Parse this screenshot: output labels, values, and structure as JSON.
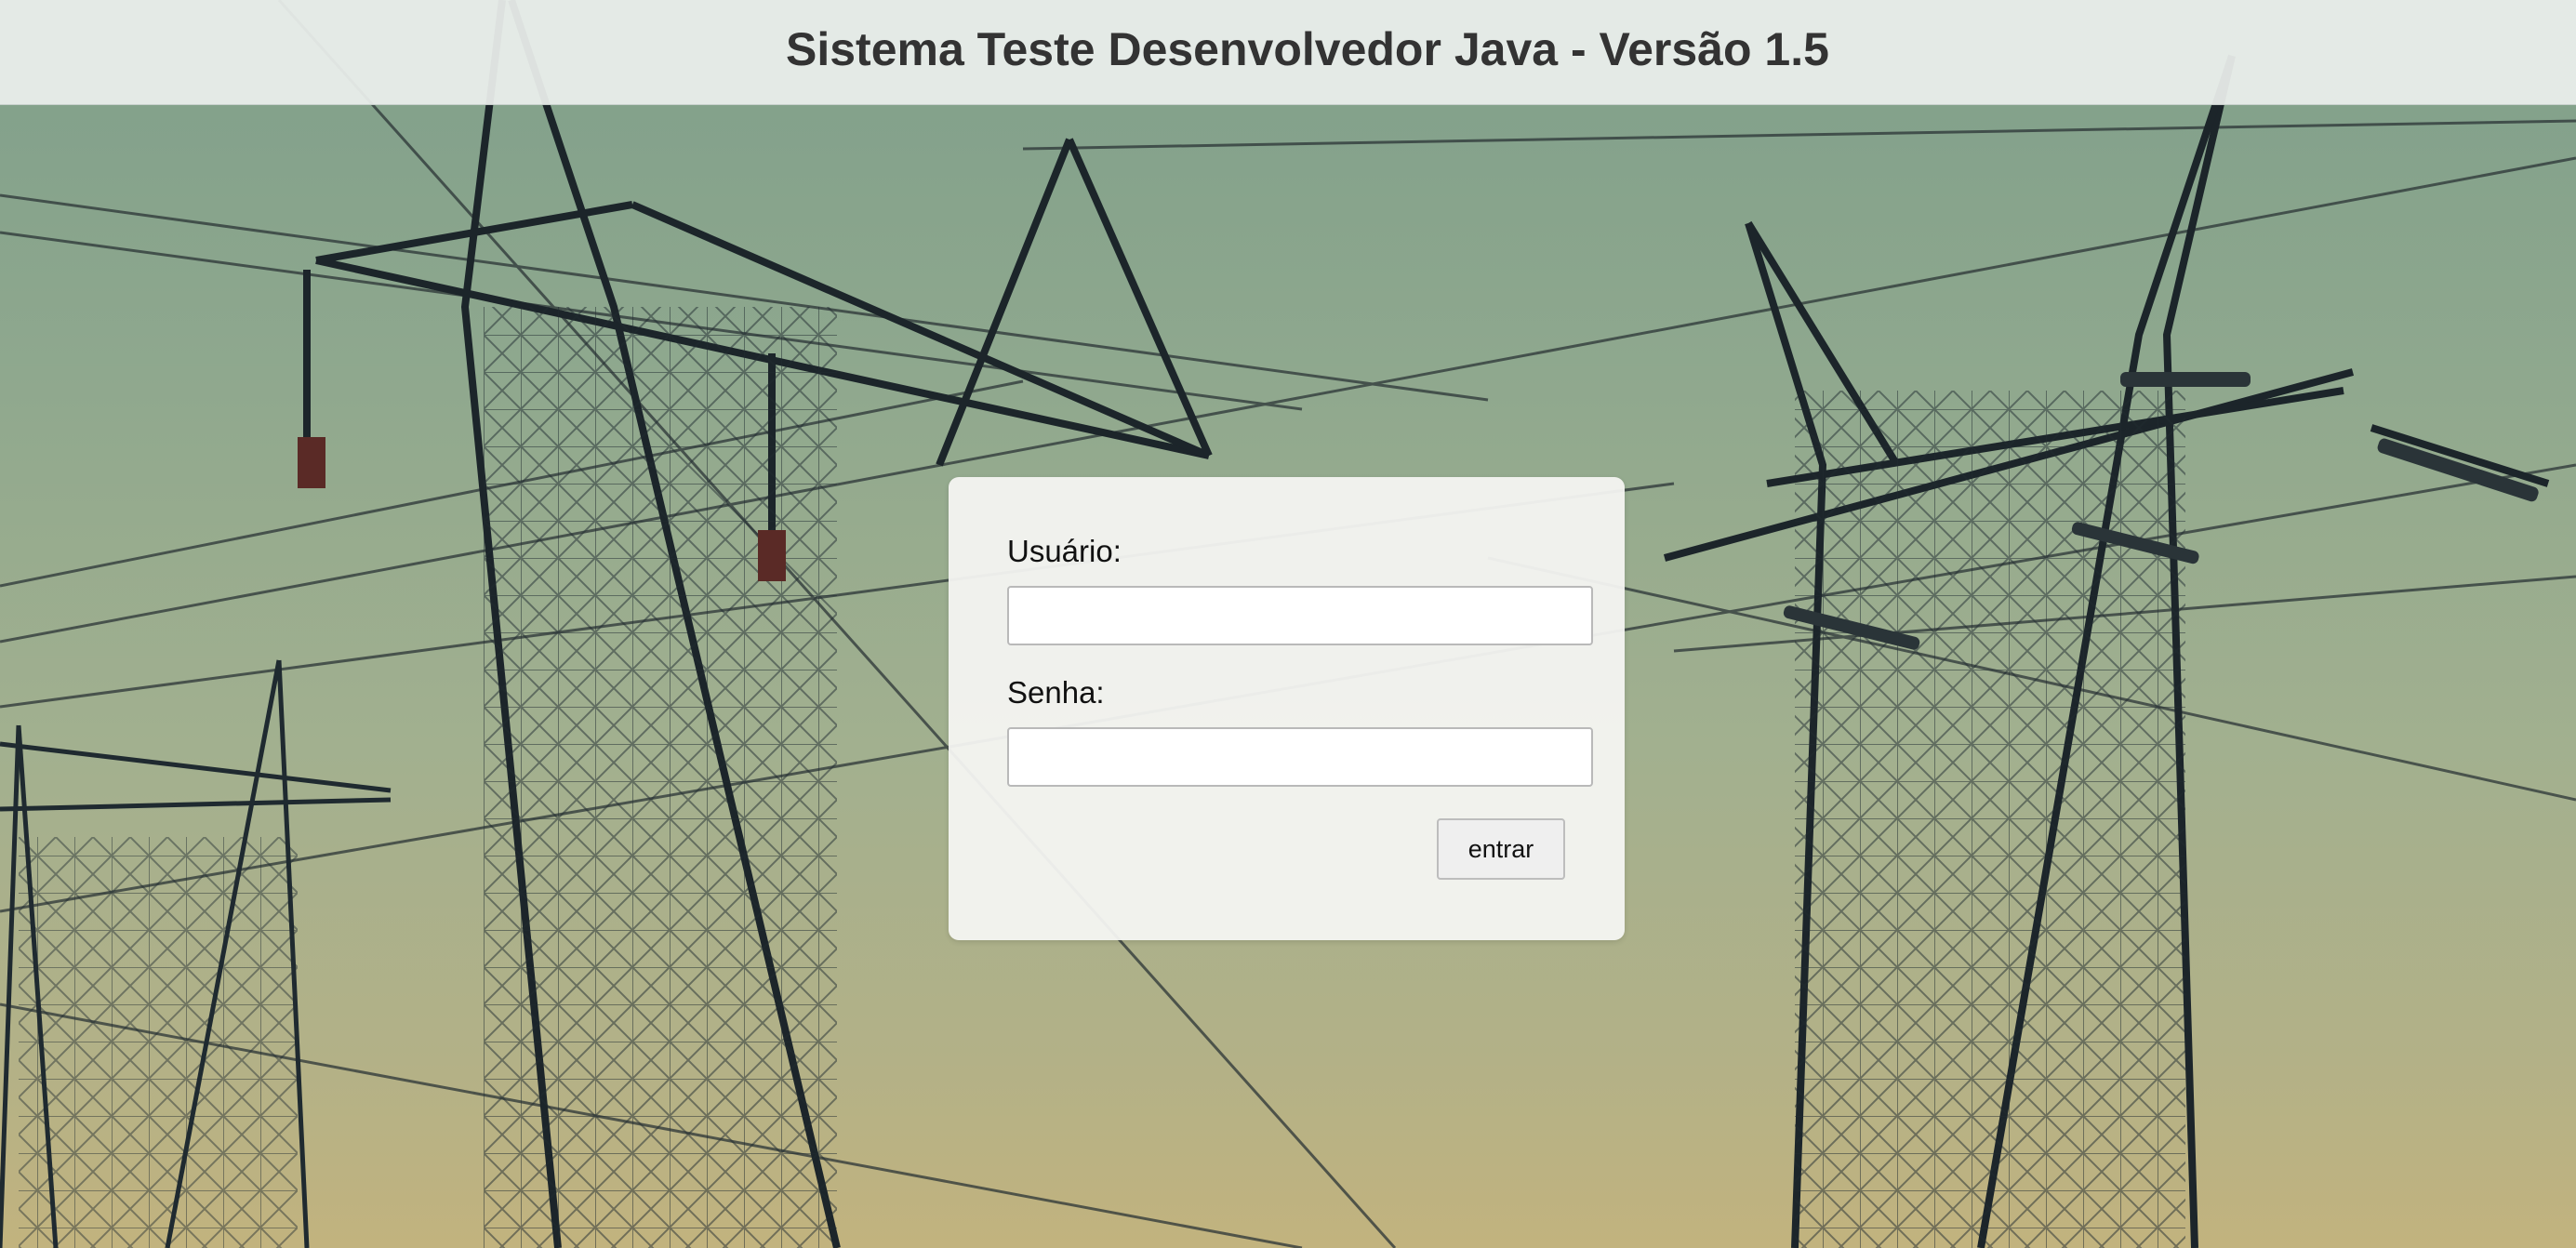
{
  "header": {
    "title": "Sistema Teste Desenvolvedor Java - Versão 1.5"
  },
  "login": {
    "user_label": "Usuário:",
    "user_value": "",
    "password_label": "Senha:",
    "password_value": "",
    "submit_label": "entrar"
  },
  "colors": {
    "header_background": "#ecf0ed",
    "card_background": "#f5f5f3",
    "title_text": "#333333",
    "button_background": "#efefef"
  }
}
